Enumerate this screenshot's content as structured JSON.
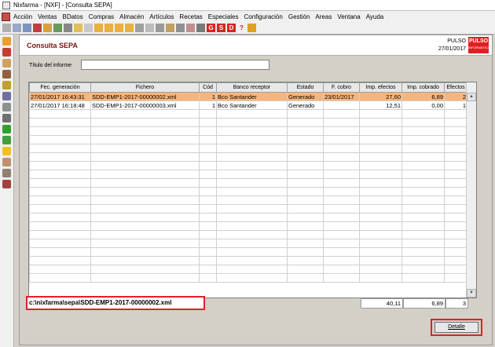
{
  "window": {
    "title": "Nixfarma - [NXF] - [Consulta SEPA]"
  },
  "menu": [
    "Acción",
    "Ventas",
    "BDatos",
    "Compras",
    "Almacén",
    "Artículos",
    "Recetas",
    "Especiales",
    "Configuración",
    "Gestión",
    "Areas",
    "Ventana",
    "Ayuda"
  ],
  "toolbar": {
    "g_label": "G",
    "s_label": "S",
    "d_label": "D",
    "help_label": "?"
  },
  "panel": {
    "title": "Consulta SEPA",
    "company": "PULSO",
    "date": "27/01/2017",
    "logo": "PULSO",
    "logo_sub": "INFORMÁTICA"
  },
  "form": {
    "titulo_label": "Título del informe",
    "titulo_value": ""
  },
  "table": {
    "columns": [
      "Fec. generación",
      "Fichero",
      "Cód",
      "Banco receptor",
      "Estado",
      "F. cobro",
      "Imp. efectos",
      "Imp. cobrado",
      "Efectos"
    ],
    "rows": [
      [
        "27/01/2017 16:43:31",
        "SDD-EMP1-2017-00000002.xml",
        "1",
        "Bco Santander",
        "Generado",
        "23/01/2017",
        "27,60",
        "6,89",
        "2"
      ],
      [
        "27/01/2017 16:18:48",
        "SDD-EMP1-2017-00000003.xml",
        "1",
        "Bco Santander",
        "Generado",
        "",
        "12,51",
        "0,00",
        "1"
      ]
    ]
  },
  "footer": {
    "path": "c:\\nixfarma\\sepa\\SDD-EMP1-2017-00000002.xml",
    "total_efectos": "40,11",
    "total_cobrado": "6,89",
    "total_count": "3"
  },
  "buttons": {
    "detalle": "Detalle"
  }
}
